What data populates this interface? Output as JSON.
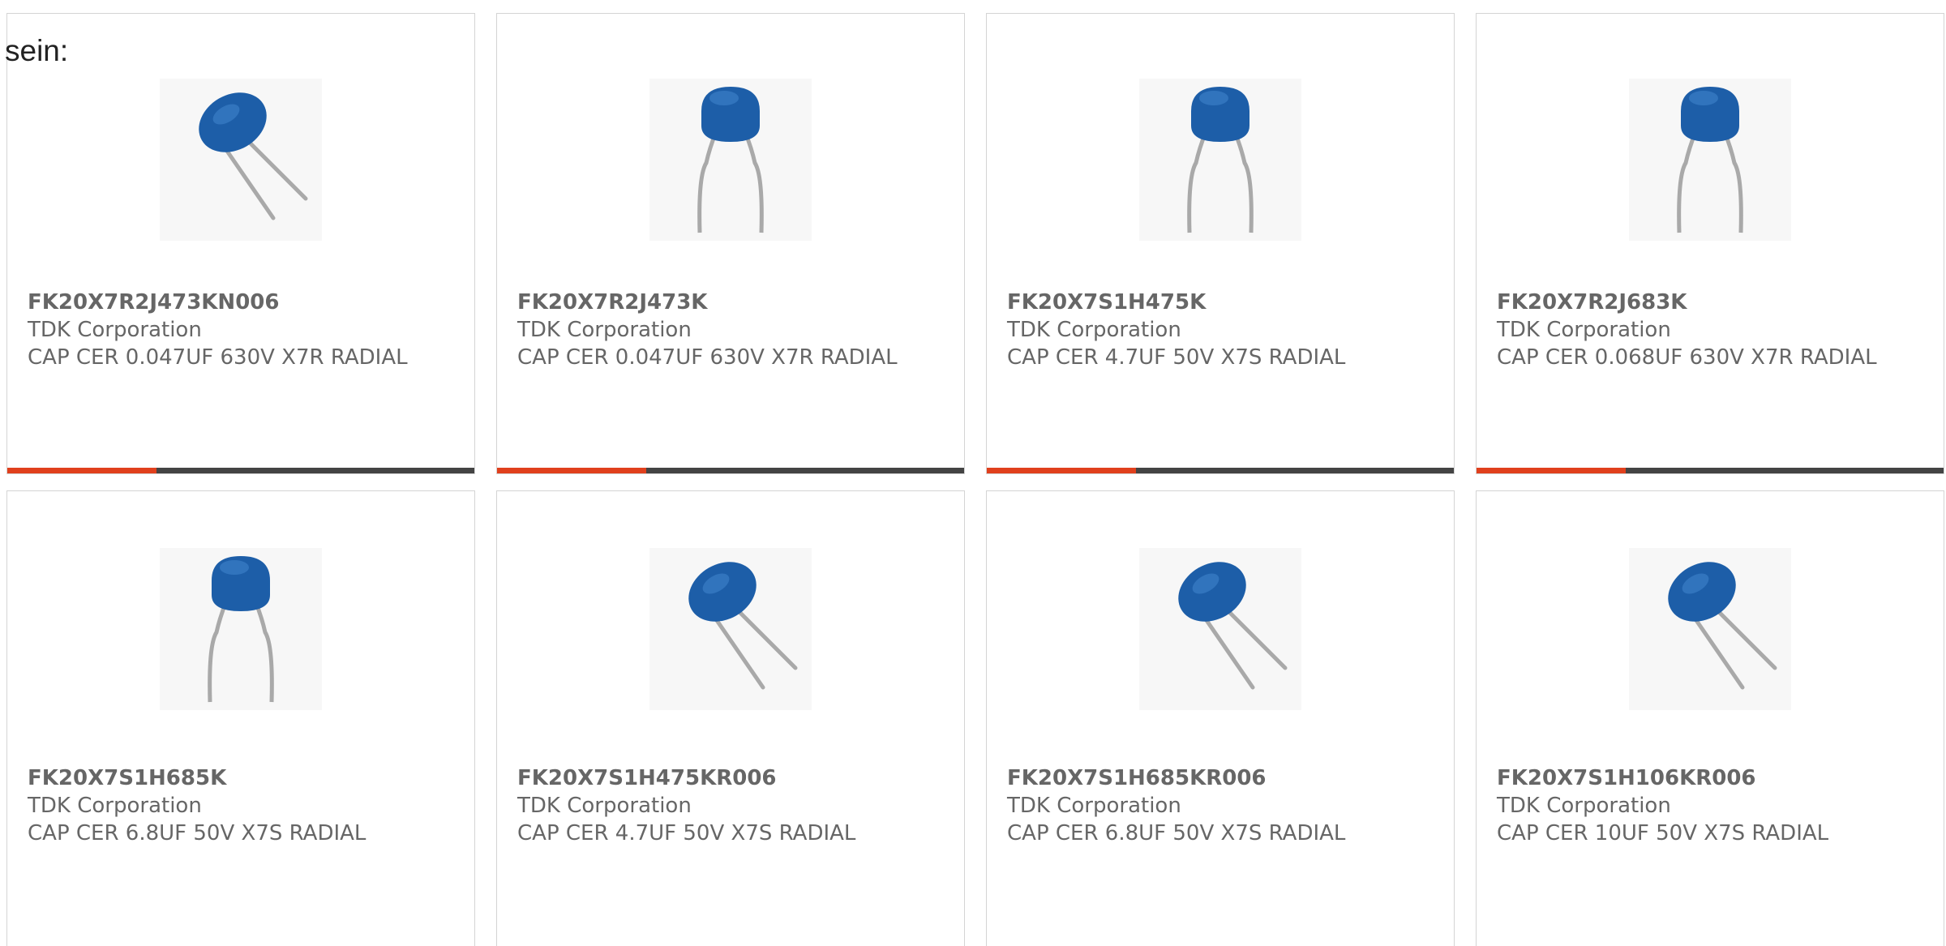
{
  "intro_text": "sein:",
  "colors": {
    "accent": "#e0401d",
    "track": "#444444",
    "capacitor_body": "#1d5ea8",
    "lead": "#a9a9a9",
    "text": "#666666"
  },
  "products": [
    {
      "part_number": "FK20X7R2J473KN006",
      "manufacturer": "TDK Corporation",
      "description": "CAP CER 0.047UF 630V X7R RADIAL",
      "image_icon": "capacitor-tilted-icon",
      "progress": 0.32
    },
    {
      "part_number": "FK20X7R2J473K",
      "manufacturer": "TDK Corporation",
      "description": "CAP CER 0.047UF 630V X7R RADIAL",
      "image_icon": "capacitor-upright-icon",
      "progress": 0.32
    },
    {
      "part_number": "FK20X7S1H475K",
      "manufacturer": "TDK Corporation",
      "description": "CAP CER 4.7UF 50V X7S RADIAL",
      "image_icon": "capacitor-upright-icon",
      "progress": 0.32
    },
    {
      "part_number": "FK20X7R2J683K",
      "manufacturer": "TDK Corporation",
      "description": "CAP CER 0.068UF 630V X7R RADIAL",
      "image_icon": "capacitor-upright-icon",
      "progress": 0.32
    },
    {
      "part_number": "FK20X7S1H685K",
      "manufacturer": "TDK Corporation",
      "description": "CAP CER 6.8UF 50V X7S RADIAL",
      "image_icon": "capacitor-upright-icon"
    },
    {
      "part_number": "FK20X7S1H475KR006",
      "manufacturer": "TDK Corporation",
      "description": "CAP CER 4.7UF 50V X7S RADIAL",
      "image_icon": "capacitor-tilted-icon"
    },
    {
      "part_number": "FK20X7S1H685KR006",
      "manufacturer": "TDK Corporation",
      "description": "CAP CER 6.8UF 50V X7S RADIAL",
      "image_icon": "capacitor-tilted-icon"
    },
    {
      "part_number": "FK20X7S1H106KR006",
      "manufacturer": "TDK Corporation",
      "description": "CAP CER 10UF 50V X7S RADIAL",
      "image_icon": "capacitor-tilted-icon"
    }
  ]
}
